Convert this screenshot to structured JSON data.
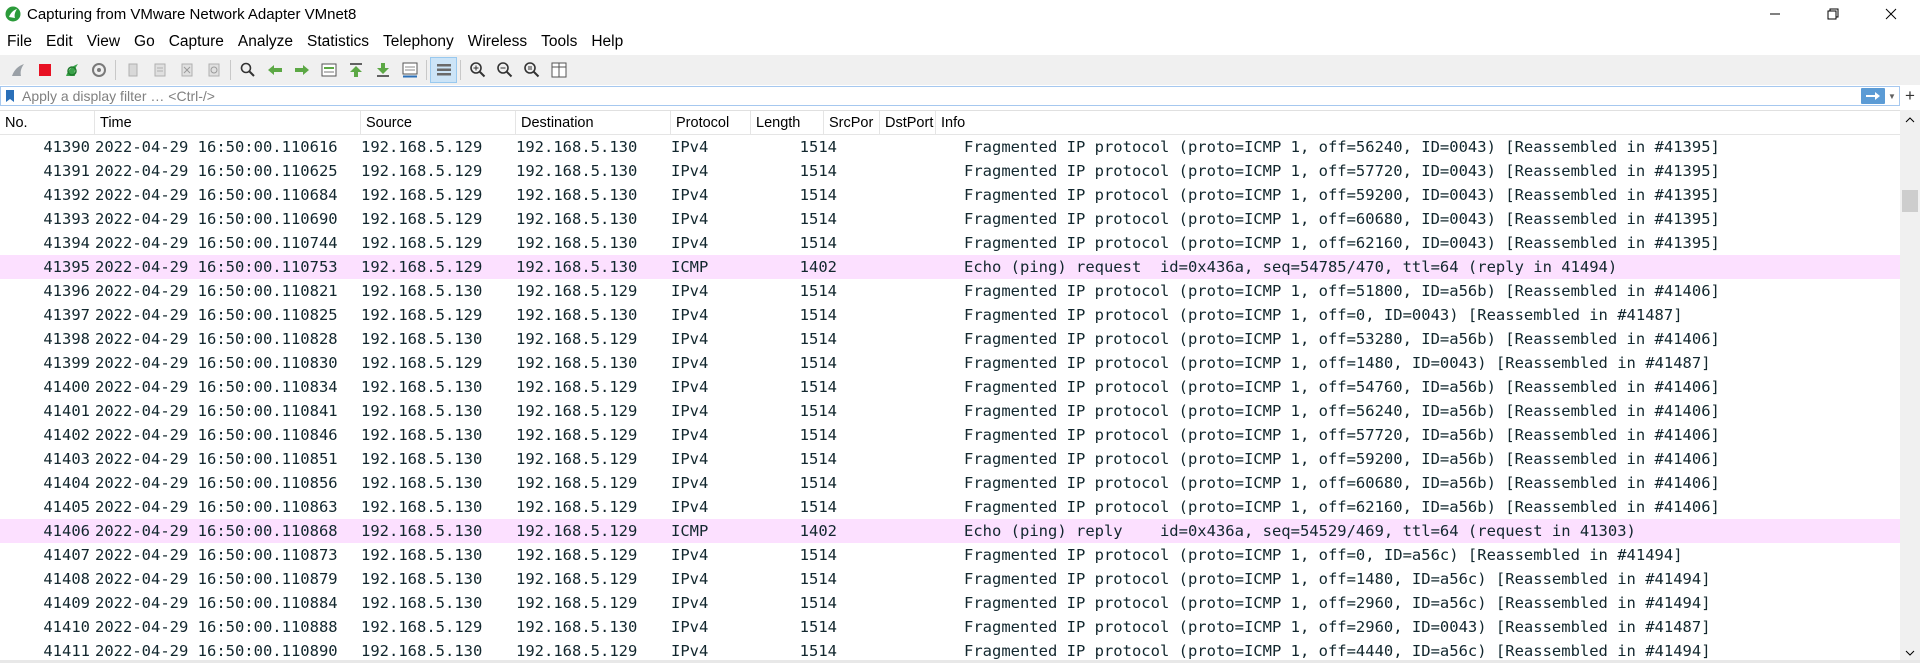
{
  "window": {
    "title": "Capturing from VMware Network Adapter VMnet8",
    "icons": {
      "app": "wireshark-fin-icon",
      "minimize": "minimize-icon",
      "maximize": "restore-icon",
      "close": "close-icon"
    }
  },
  "menu": {
    "items": [
      "File",
      "Edit",
      "View",
      "Go",
      "Capture",
      "Analyze",
      "Statistics",
      "Telephony",
      "Wireless",
      "Tools",
      "Help"
    ]
  },
  "toolbar": {
    "buttons": [
      "start-capture-icon",
      "stop-capture-icon",
      "restart-capture-icon",
      "capture-options-icon",
      "open-file-icon",
      "save-file-icon",
      "close-file-icon",
      "reload-file-icon",
      "find-packet-icon",
      "go-back-icon",
      "go-forward-icon",
      "go-to-packet-icon",
      "go-first-icon",
      "go-last-icon",
      "autoscroll-icon",
      "colorize-icon",
      "zoom-in-icon",
      "zoom-out-icon",
      "zoom-normal-icon",
      "resize-columns-icon"
    ]
  },
  "filter": {
    "placeholder": "Apply a display filter … <Ctrl-/>",
    "value": ""
  },
  "columns": {
    "no": "No.",
    "time": "Time",
    "source": "Source",
    "destination": "Destination",
    "protocol": "Protocol",
    "length": "Length",
    "srcport": "SrcPor",
    "dstport": "DstPort",
    "info": "Info"
  },
  "colors": {
    "icmp_row": "#fce0ff",
    "text": "#12272e",
    "accent": "#5b9bd5"
  },
  "packets": [
    {
      "no": "41390",
      "time": "2022-04-29 16:50:00.110616",
      "src": "192.168.5.129",
      "dst": "192.168.5.130",
      "proto": "IPv4",
      "len": "1514",
      "info": "Fragmented IP protocol (proto=ICMP 1, off=56240, ID=0043) [Reassembled in #41395]"
    },
    {
      "no": "41391",
      "time": "2022-04-29 16:50:00.110625",
      "src": "192.168.5.129",
      "dst": "192.168.5.130",
      "proto": "IPv4",
      "len": "1514",
      "info": "Fragmented IP protocol (proto=ICMP 1, off=57720, ID=0043) [Reassembled in #41395]"
    },
    {
      "no": "41392",
      "time": "2022-04-29 16:50:00.110684",
      "src": "192.168.5.129",
      "dst": "192.168.5.130",
      "proto": "IPv4",
      "len": "1514",
      "info": "Fragmented IP protocol (proto=ICMP 1, off=59200, ID=0043) [Reassembled in #41395]"
    },
    {
      "no": "41393",
      "time": "2022-04-29 16:50:00.110690",
      "src": "192.168.5.129",
      "dst": "192.168.5.130",
      "proto": "IPv4",
      "len": "1514",
      "info": "Fragmented IP protocol (proto=ICMP 1, off=60680, ID=0043) [Reassembled in #41395]"
    },
    {
      "no": "41394",
      "time": "2022-04-29 16:50:00.110744",
      "src": "192.168.5.129",
      "dst": "192.168.5.130",
      "proto": "IPv4",
      "len": "1514",
      "info": "Fragmented IP protocol (proto=ICMP 1, off=62160, ID=0043) [Reassembled in #41395]"
    },
    {
      "no": "41395",
      "time": "2022-04-29 16:50:00.110753",
      "src": "192.168.5.129",
      "dst": "192.168.5.130",
      "proto": "ICMP",
      "len": "1402",
      "info": "Echo (ping) request  id=0x436a, seq=54785/470, ttl=64 (reply in 41494)",
      "highlight": true
    },
    {
      "no": "41396",
      "time": "2022-04-29 16:50:00.110821",
      "src": "192.168.5.130",
      "dst": "192.168.5.129",
      "proto": "IPv4",
      "len": "1514",
      "info": "Fragmented IP protocol (proto=ICMP 1, off=51800, ID=a56b) [Reassembled in #41406]"
    },
    {
      "no": "41397",
      "time": "2022-04-29 16:50:00.110825",
      "src": "192.168.5.129",
      "dst": "192.168.5.130",
      "proto": "IPv4",
      "len": "1514",
      "info": "Fragmented IP protocol (proto=ICMP 1, off=0, ID=0043) [Reassembled in #41487]"
    },
    {
      "no": "41398",
      "time": "2022-04-29 16:50:00.110828",
      "src": "192.168.5.130",
      "dst": "192.168.5.129",
      "proto": "IPv4",
      "len": "1514",
      "info": "Fragmented IP protocol (proto=ICMP 1, off=53280, ID=a56b) [Reassembled in #41406]"
    },
    {
      "no": "41399",
      "time": "2022-04-29 16:50:00.110830",
      "src": "192.168.5.129",
      "dst": "192.168.5.130",
      "proto": "IPv4",
      "len": "1514",
      "info": "Fragmented IP protocol (proto=ICMP 1, off=1480, ID=0043) [Reassembled in #41487]"
    },
    {
      "no": "41400",
      "time": "2022-04-29 16:50:00.110834",
      "src": "192.168.5.130",
      "dst": "192.168.5.129",
      "proto": "IPv4",
      "len": "1514",
      "info": "Fragmented IP protocol (proto=ICMP 1, off=54760, ID=a56b) [Reassembled in #41406]"
    },
    {
      "no": "41401",
      "time": "2022-04-29 16:50:00.110841",
      "src": "192.168.5.130",
      "dst": "192.168.5.129",
      "proto": "IPv4",
      "len": "1514",
      "info": "Fragmented IP protocol (proto=ICMP 1, off=56240, ID=a56b) [Reassembled in #41406]"
    },
    {
      "no": "41402",
      "time": "2022-04-29 16:50:00.110846",
      "src": "192.168.5.130",
      "dst": "192.168.5.129",
      "proto": "IPv4",
      "len": "1514",
      "info": "Fragmented IP protocol (proto=ICMP 1, off=57720, ID=a56b) [Reassembled in #41406]"
    },
    {
      "no": "41403",
      "time": "2022-04-29 16:50:00.110851",
      "src": "192.168.5.130",
      "dst": "192.168.5.129",
      "proto": "IPv4",
      "len": "1514",
      "info": "Fragmented IP protocol (proto=ICMP 1, off=59200, ID=a56b) [Reassembled in #41406]"
    },
    {
      "no": "41404",
      "time": "2022-04-29 16:50:00.110856",
      "src": "192.168.5.130",
      "dst": "192.168.5.129",
      "proto": "IPv4",
      "len": "1514",
      "info": "Fragmented IP protocol (proto=ICMP 1, off=60680, ID=a56b) [Reassembled in #41406]"
    },
    {
      "no": "41405",
      "time": "2022-04-29 16:50:00.110863",
      "src": "192.168.5.130",
      "dst": "192.168.5.129",
      "proto": "IPv4",
      "len": "1514",
      "info": "Fragmented IP protocol (proto=ICMP 1, off=62160, ID=a56b) [Reassembled in #41406]"
    },
    {
      "no": "41406",
      "time": "2022-04-29 16:50:00.110868",
      "src": "192.168.5.130",
      "dst": "192.168.5.129",
      "proto": "ICMP",
      "len": "1402",
      "info": "Echo (ping) reply    id=0x436a, seq=54529/469, ttl=64 (request in 41303)",
      "highlight": true
    },
    {
      "no": "41407",
      "time": "2022-04-29 16:50:00.110873",
      "src": "192.168.5.130",
      "dst": "192.168.5.129",
      "proto": "IPv4",
      "len": "1514",
      "info": "Fragmented IP protocol (proto=ICMP 1, off=0, ID=a56c) [Reassembled in #41494]"
    },
    {
      "no": "41408",
      "time": "2022-04-29 16:50:00.110879",
      "src": "192.168.5.130",
      "dst": "192.168.5.129",
      "proto": "IPv4",
      "len": "1514",
      "info": "Fragmented IP protocol (proto=ICMP 1, off=1480, ID=a56c) [Reassembled in #41494]"
    },
    {
      "no": "41409",
      "time": "2022-04-29 16:50:00.110884",
      "src": "192.168.5.130",
      "dst": "192.168.5.129",
      "proto": "IPv4",
      "len": "1514",
      "info": "Fragmented IP protocol (proto=ICMP 1, off=2960, ID=a56c) [Reassembled in #41494]"
    },
    {
      "no": "41410",
      "time": "2022-04-29 16:50:00.110888",
      "src": "192.168.5.129",
      "dst": "192.168.5.130",
      "proto": "IPv4",
      "len": "1514",
      "info": "Fragmented IP protocol (proto=ICMP 1, off=2960, ID=0043) [Reassembled in #41487]"
    },
    {
      "no": "41411",
      "time": "2022-04-29 16:50:00.110890",
      "src": "192.168.5.130",
      "dst": "192.168.5.129",
      "proto": "IPv4",
      "len": "1514",
      "info": "Fragmented IP protocol (proto=ICMP 1, off=4440, ID=a56c) [Reassembled in #41494]"
    }
  ]
}
